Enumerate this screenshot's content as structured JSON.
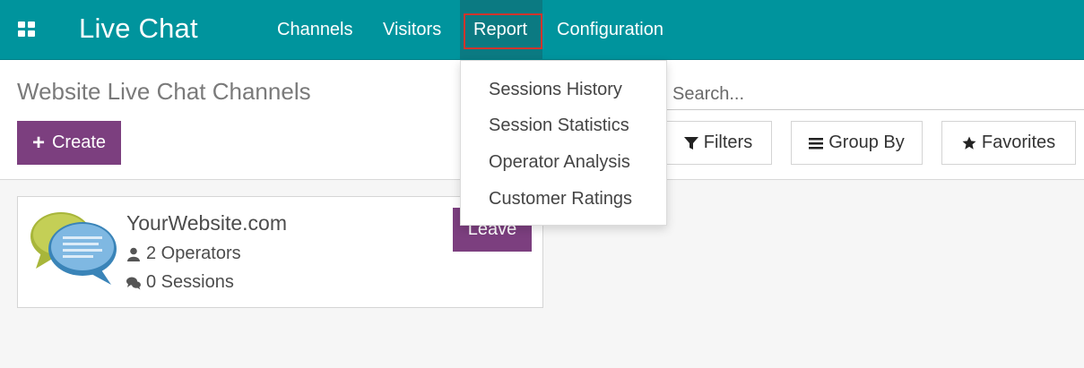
{
  "navbar": {
    "brand": "Live Chat",
    "items": [
      {
        "label": "Channels"
      },
      {
        "label": "Visitors"
      },
      {
        "label": "Report"
      },
      {
        "label": "Configuration"
      }
    ]
  },
  "report_menu": {
    "items": [
      {
        "label": "Sessions History"
      },
      {
        "label": "Session Statistics"
      },
      {
        "label": "Operator Analysis"
      },
      {
        "label": "Customer Ratings"
      }
    ]
  },
  "control_panel": {
    "title": "Website Live Chat Channels",
    "create_label": "Create",
    "search_placeholder": "Search...",
    "filters_label": "Filters",
    "group_by_label": "Group By",
    "favorites_label": "Favorites"
  },
  "channel_card": {
    "name": "YourWebsite.com",
    "operators": "2 Operators",
    "sessions": "0 Sessions",
    "leave_label": "Leave"
  },
  "colors": {
    "navbar": "#00949d",
    "primary_button": "#7c3f7f",
    "highlight_box": "#d0342c"
  }
}
